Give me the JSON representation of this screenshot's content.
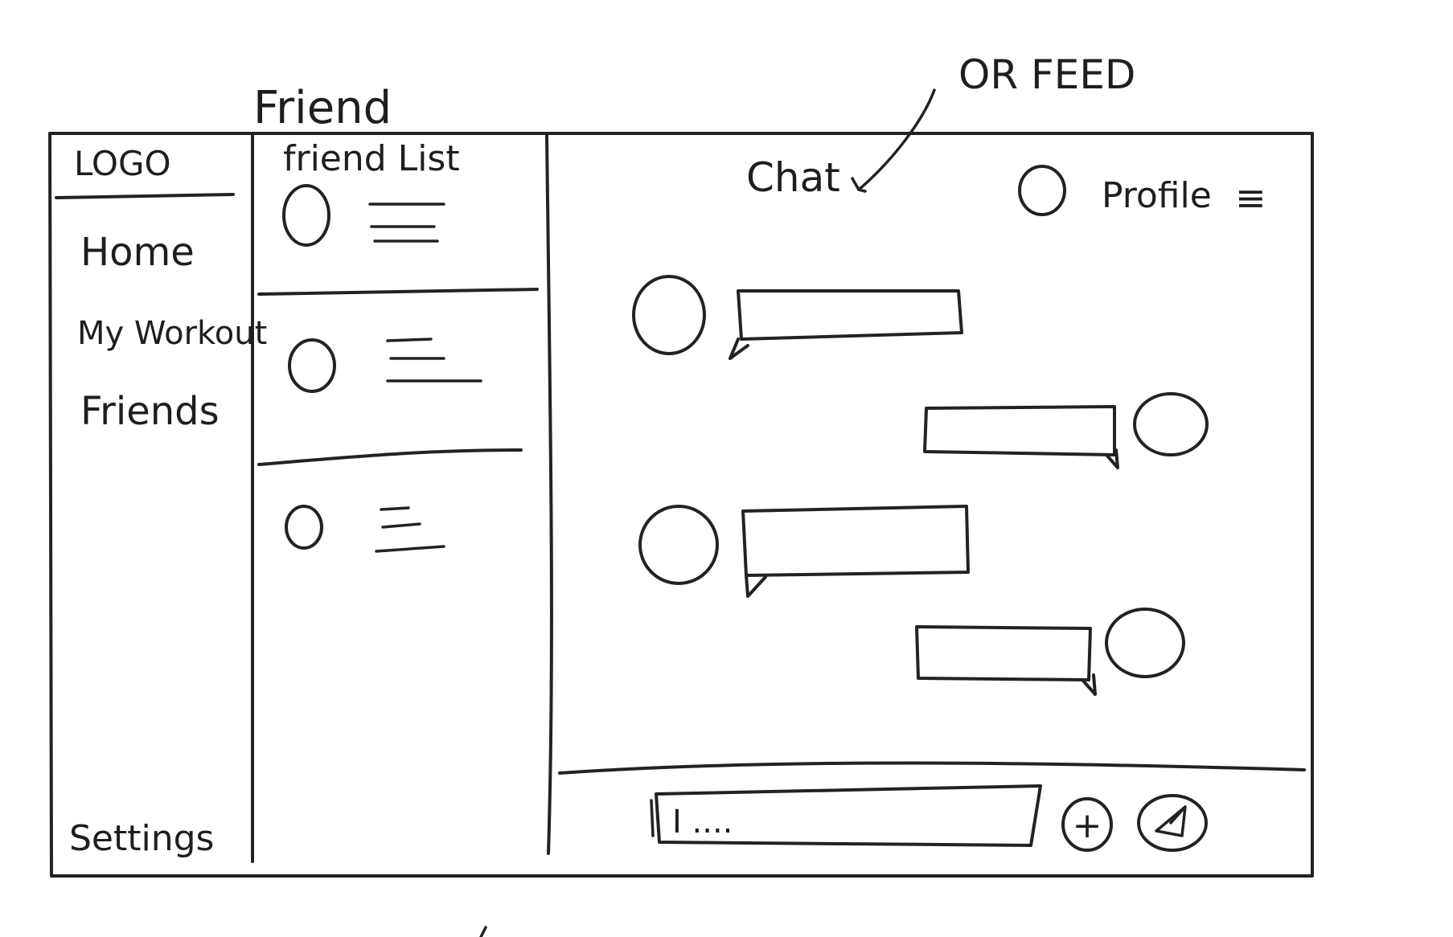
{
  "annotations": {
    "friend": "Friend",
    "or_feed": "OR FEED"
  },
  "sidebar": {
    "logo": "LOGO",
    "items": [
      {
        "label": "Home"
      },
      {
        "label": "My Workout"
      },
      {
        "label": "Friends"
      }
    ],
    "settings": "Settings"
  },
  "friend_list": {
    "title": "friend List",
    "items": [
      {
        "avatar": "avatar-circle",
        "text": "text-lines-icon"
      },
      {
        "avatar": "avatar-circle",
        "text": "text-lines-icon"
      },
      {
        "avatar": "avatar-circle",
        "text": "text-lines-icon"
      }
    ]
  },
  "chat": {
    "title": "Chat",
    "profile_label": "Profile",
    "menu_icon": "≡",
    "messages": [
      {
        "side": "left"
      },
      {
        "side": "right"
      },
      {
        "side": "left"
      },
      {
        "side": "right"
      }
    ],
    "input": {
      "value": "I ...."
    },
    "add_icon": "+",
    "send_icon": "send-icon"
  }
}
